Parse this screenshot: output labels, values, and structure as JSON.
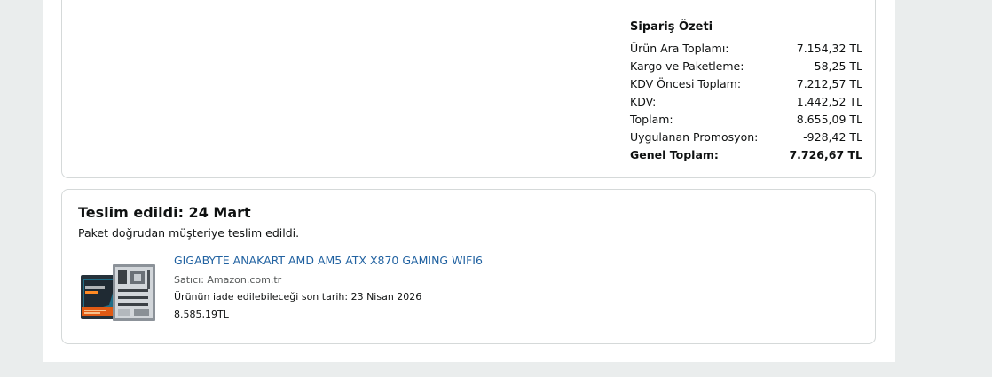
{
  "order_summary": {
    "title": "Sipariş Özeti",
    "rows": [
      {
        "label": "Ürün Ara Toplamı:",
        "value": "7.154,32 TL"
      },
      {
        "label": "Kargo ve Paketleme:",
        "value": "58,25 TL"
      },
      {
        "label": "KDV Öncesi Toplam:",
        "value": "7.212,57 TL"
      },
      {
        "label": "KDV:",
        "value": "1.442,52 TL"
      },
      {
        "label": "Toplam:",
        "value": "8.655,09 TL"
      },
      {
        "label": "Uygulanan Promosyon:",
        "value": "-928,42 TL"
      },
      {
        "label": "Genel Toplam:",
        "value": "7.726,67 TL"
      }
    ]
  },
  "delivery": {
    "title": "Teslim edildi: 24 Mart",
    "note": "Paket doğrudan müşteriye teslim edildi.",
    "product": {
      "name": "GIGABYTE ANAKART AMD AM5 ATX X870 GAMING WIFI6",
      "seller": "Satıcı: Amazon.com.tr",
      "return_date": "Ürünün iade edilebileceği son tarih: 23 Nisan 2026",
      "price": "8.585,19TL",
      "image_icon": "motherboard-product-image"
    }
  },
  "colors": {
    "link": "#2162a1",
    "border": "#d5d9d9",
    "page_background": "#eaeded"
  }
}
